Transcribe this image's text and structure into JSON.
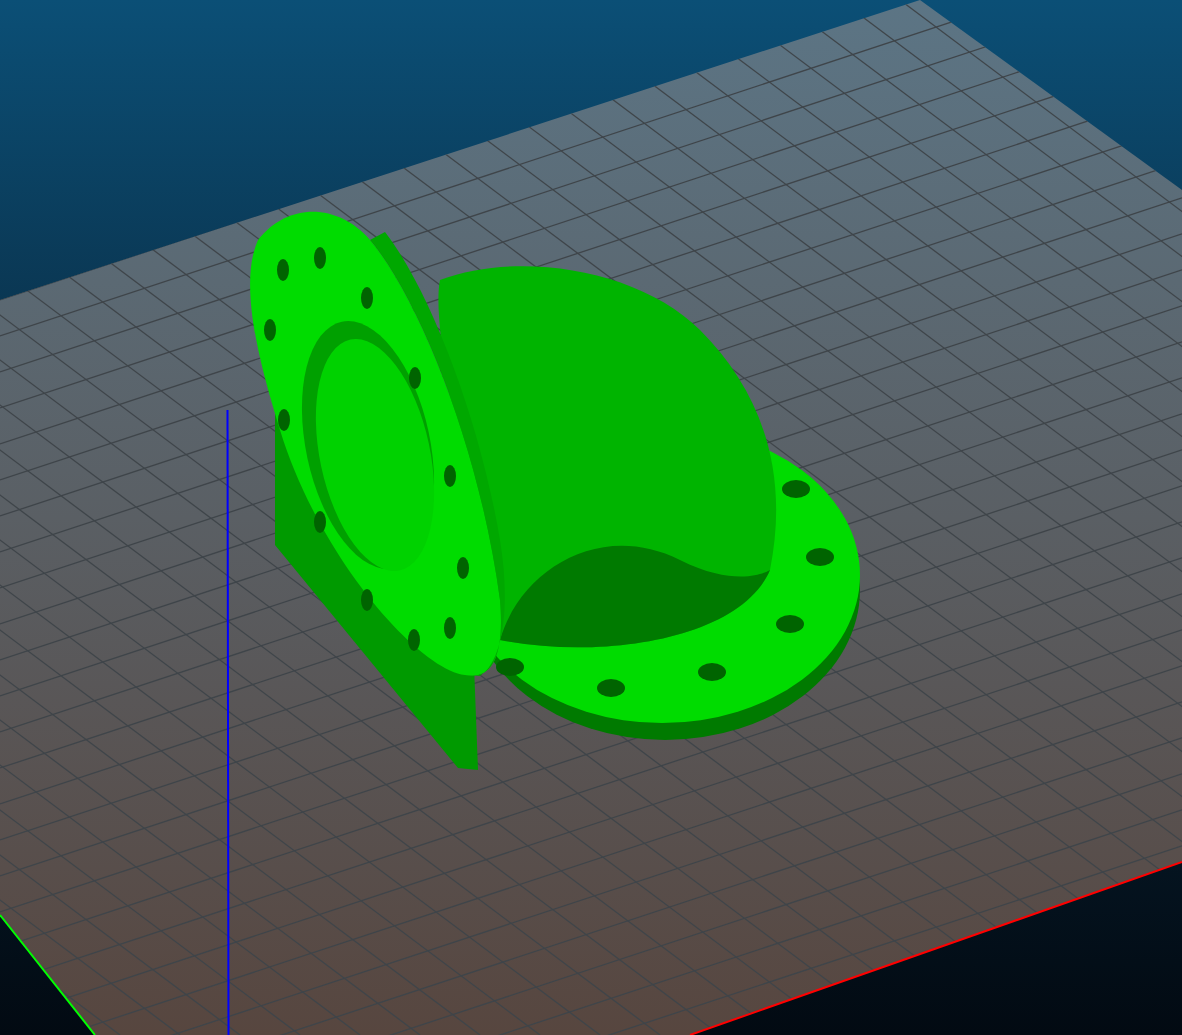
{
  "axes": [
    {
      "kind": "x",
      "color": "#ff0000"
    },
    {
      "kind": "y",
      "color": "#00ff00"
    },
    {
      "kind": "z",
      "color": "#0000ff"
    }
  ]
}
